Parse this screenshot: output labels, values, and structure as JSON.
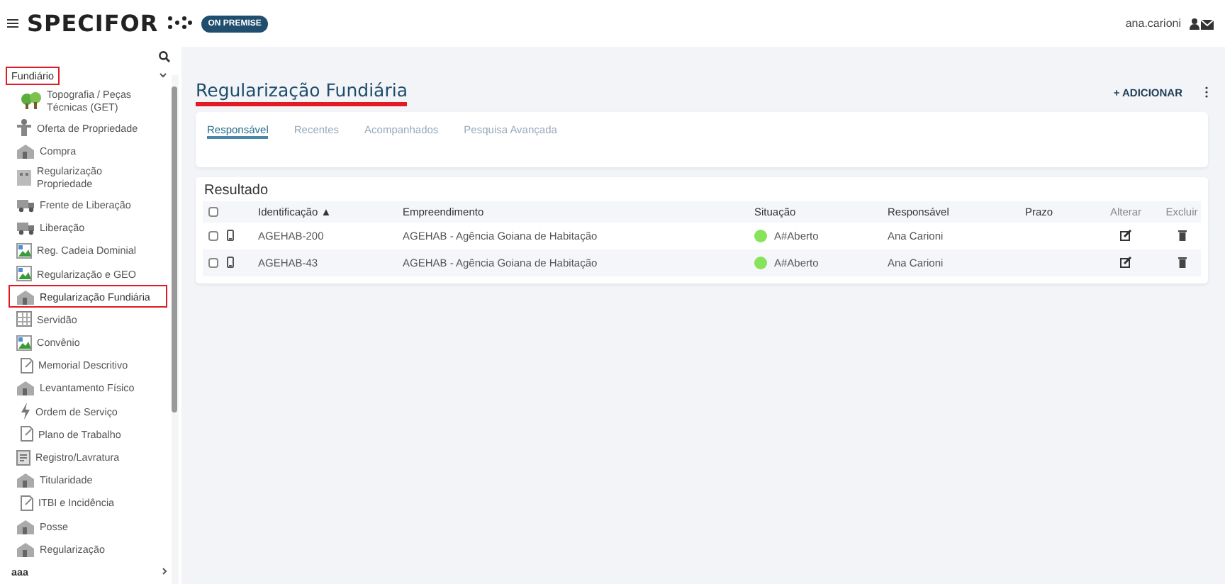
{
  "header": {
    "brand": "SPECIFOR",
    "badge": "ON PREMISE",
    "user": "ana.carioni"
  },
  "sidebar": {
    "group": {
      "label": "Fundiário",
      "highlighted": true,
      "expanded": true
    },
    "items": [
      {
        "label": "Topografia / Peças Técnicas (GET)",
        "kind": "trees",
        "selected": false
      },
      {
        "label": "Oferta de Propriedade",
        "kind": "person",
        "selected": false
      },
      {
        "label": "Compra",
        "kind": "house",
        "selected": false
      },
      {
        "label": "Regularização Propriedade",
        "kind": "building",
        "selected": false
      },
      {
        "label": "Frente de Liberação",
        "kind": "truck",
        "selected": false
      },
      {
        "label": "Liberação",
        "kind": "truck",
        "selected": false
      },
      {
        "label": "Reg. Cadeia Dominial",
        "kind": "broken",
        "selected": false
      },
      {
        "label": "Regularização e GEO",
        "kind": "broken",
        "selected": false
      },
      {
        "label": "Regularização Fundiária",
        "kind": "house",
        "selected": true
      },
      {
        "label": "Servidão",
        "kind": "grid",
        "selected": false
      },
      {
        "label": "Convênio",
        "kind": "broken",
        "selected": false
      },
      {
        "label": "Memorial Descritivo",
        "kind": "doc",
        "selected": false
      },
      {
        "label": "Levantamento Físico",
        "kind": "house",
        "selected": false
      },
      {
        "label": "Ordem de Serviço",
        "kind": "bolt",
        "selected": false
      },
      {
        "label": "Plano de Trabalho",
        "kind": "doc",
        "selected": false
      },
      {
        "label": "Registro/Lavratura",
        "kind": "register",
        "selected": false
      },
      {
        "label": "Titularidade",
        "kind": "house",
        "selected": false
      },
      {
        "label": "ITBI e Incidência",
        "kind": "doc",
        "selected": false
      },
      {
        "label": "Posse",
        "kind": "house",
        "selected": false
      },
      {
        "label": "Regularização",
        "kind": "house",
        "selected": false
      }
    ],
    "next_group": {
      "label": "aaa",
      "expanded": false
    }
  },
  "page": {
    "title": {
      "text": "Regularização Fundiária",
      "highlighted": true
    },
    "add_button": "+ ADICIONAR"
  },
  "tabs": [
    {
      "label": "Responsável",
      "selected": true
    },
    {
      "label": "Recentes",
      "selected": false
    },
    {
      "label": "Acompanhados",
      "selected": false
    },
    {
      "label": "Pesquisa Avançada",
      "selected": false
    }
  ],
  "table": {
    "title": "Resultado",
    "all_checked": false,
    "columns": [
      "Identificação ▲",
      "Empreendimento",
      "Situação",
      "Responsável",
      "Prazo",
      "Alterar",
      "Excluir"
    ],
    "rows": [
      {
        "checked": false,
        "id": "AGEHAB-200",
        "empreendimento": "AGEHAB - Agência Goiana de Habitação",
        "situacao": "A#Aberto",
        "color": "#86e35a",
        "responsavel": "Ana Carioni"
      },
      {
        "checked": false,
        "id": "AGEHAB-43",
        "empreendimento": "AGEHAB - Agência Goiana de Habitação",
        "situacao": "A#Aberto",
        "color": "#86e35a",
        "responsavel": "Ana Carioni"
      }
    ]
  }
}
